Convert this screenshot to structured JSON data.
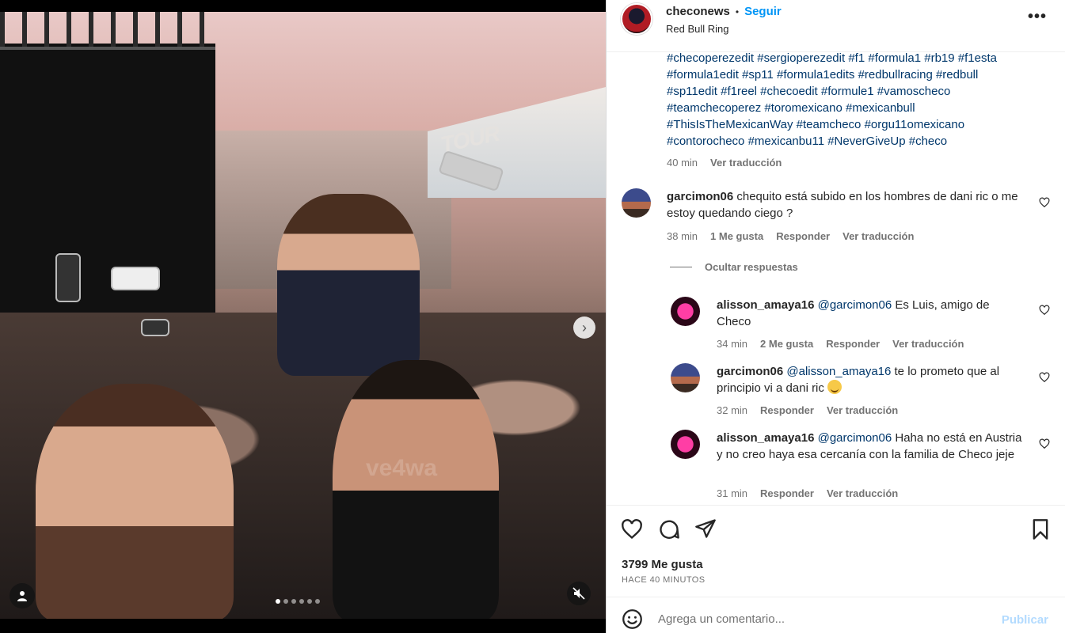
{
  "post": {
    "username": "checonews",
    "separator": "•",
    "follow_label": "Seguir",
    "location": "Red Bull Ring",
    "more_icon": "more-horizontal-icon",
    "more_label": "•••"
  },
  "caption": {
    "lines": [
      [
        "#checoperezedit",
        "#sergioperezedit",
        "#f1",
        "#formula1",
        "#rb19",
        "#f1esta"
      ],
      [
        "#formula1edit",
        "#sp11",
        "#formula1edits",
        "#redbullracing",
        "#redbull"
      ],
      [
        "#sp11edit",
        "#f1reel",
        "#checoedit",
        "#formule1",
        "#vamoscheco"
      ],
      [
        "#teamchecoperez",
        "#toromexicano",
        "#mexicanbull"
      ],
      [
        "#ThisIsTheMexicanWay",
        "#teamcheco",
        "#orgu11omexicano"
      ],
      [
        "#contorocheco",
        "#mexicanbu11",
        "#NeverGiveUp",
        "#checo"
      ]
    ],
    "time": "40 min",
    "translate": "Ver traducción"
  },
  "comments": [
    {
      "user": "garcimon06",
      "text": "chequito está subido en los hombres de dani ric o me estoy quedando ciego ?",
      "time": "38 min",
      "likes": "1 Me gusta",
      "reply": "Responder",
      "translate": "Ver traducción"
    }
  ],
  "hide_replies": "Ocultar respuestas",
  "replies": [
    {
      "user": "alisson_amaya16",
      "mention": "@garcimon06",
      "text": "Es Luis, amigo de Checo",
      "time": "34 min",
      "likes": "2 Me gusta",
      "reply": "Responder",
      "translate": "Ver traducción"
    },
    {
      "user": "garcimon06",
      "mention": "@alisson_amaya16",
      "text": "te lo prometo que al principio vi a dani ric",
      "emoji": "sweat-smile-emoji",
      "time": "32 min",
      "reply": "Responder",
      "translate": "Ver traducción"
    },
    {
      "user": "alisson_amaya16",
      "mention": "@garcimon06",
      "text": "Haha no está en Austria y no creo haya esa cercanía con la familia de Checo jeje",
      "time": "31 min",
      "reply": "Responder",
      "translate": "Ver traducción"
    }
  ],
  "actions": {
    "like_icon": "heart-icon",
    "comment_icon": "comment-icon",
    "share_icon": "send-icon",
    "save_icon": "bookmark-icon",
    "likes": "3799 Me gusta",
    "ago": "HACE 40 MINUTOS"
  },
  "composer": {
    "placeholder": "Agrega un comentario...",
    "publish": "Publicar",
    "emoji_icon": "smiley-icon"
  },
  "media": {
    "sign_text": "TOUR",
    "watermark": "ve4wa",
    "carousel_count": 6,
    "carousel_active": 0,
    "next_icon": "chevron-right-icon",
    "tag_icon": "user-tag-icon",
    "mute_icon": "muted-speaker-icon"
  }
}
